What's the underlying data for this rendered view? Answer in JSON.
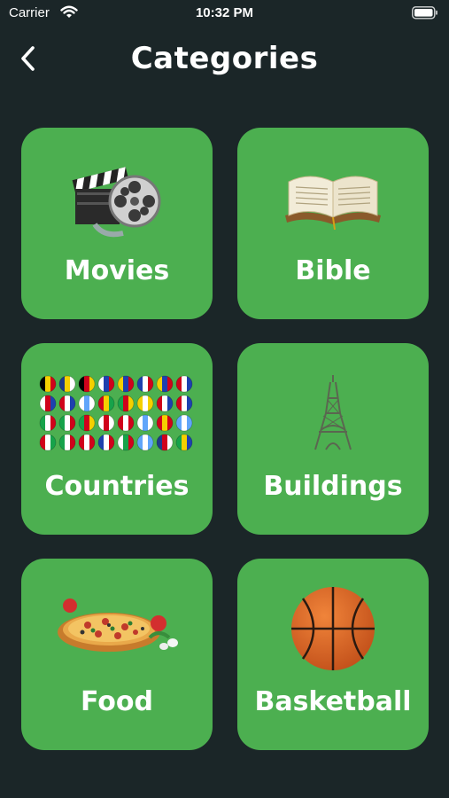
{
  "status_bar": {
    "carrier": "Carrier",
    "time": "10:32 PM"
  },
  "header": {
    "title": "Categories",
    "back_icon": "chevron-left-icon"
  },
  "colors": {
    "background": "#1b2628",
    "card": "#4caf50",
    "text": "#ffffff"
  },
  "categories": [
    {
      "label": "Movies",
      "icon": "film-reel-icon"
    },
    {
      "label": "Bible",
      "icon": "open-book-icon"
    },
    {
      "label": "Countries",
      "icon": "flags-icon"
    },
    {
      "label": "Buildings",
      "icon": "eiffel-tower-icon"
    },
    {
      "label": "Food",
      "icon": "pizza-icon"
    },
    {
      "label": "Basketball",
      "icon": "basketball-icon"
    }
  ]
}
